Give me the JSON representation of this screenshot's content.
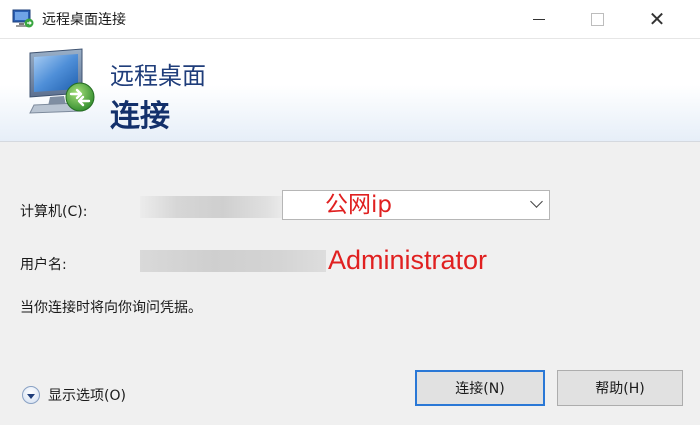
{
  "window": {
    "title": "远程桌面连接",
    "controls": {
      "minimize": "minimize",
      "maximize": "maximize",
      "close": "✕"
    }
  },
  "banner": {
    "line1": "远程桌面",
    "line2": "连接"
  },
  "form": {
    "computer_label": "计算机(C):",
    "computer_value": "公网ip",
    "username_label": "用户名:",
    "username_value": "Administrator",
    "notice": "当你连接时将向你询问凭据。"
  },
  "footer": {
    "options_label": "显示选项(O)",
    "connect_label": "连接(N)",
    "help_label": "帮助(H)"
  },
  "colors": {
    "annotation_red": "#e02020",
    "banner_text": "#13306b",
    "focus_border": "#2a78d6"
  },
  "icons": {
    "app": "remote-desktop-icon",
    "banner": "remote-desktop-monitor-icon",
    "combo_arrow": "chevron-down-icon",
    "options": "expand-circle-icon"
  }
}
